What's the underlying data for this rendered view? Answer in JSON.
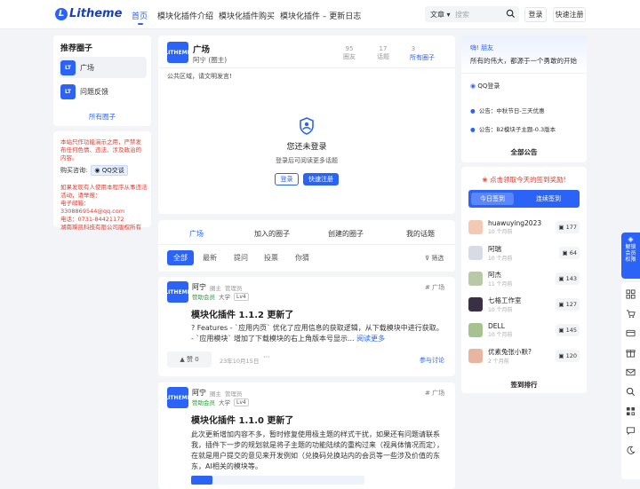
{
  "header": {
    "logo_text": "Litheme",
    "nav": [
      "首页",
      "模块化插件介绍",
      "模块化插件购买",
      "模块化插件 – 更新日志"
    ],
    "search_category": "文章",
    "search_placeholder": "搜索",
    "login": "登录",
    "register": "快速注册"
  },
  "left": {
    "title": "推荐圈子",
    "circles": [
      "广场",
      "问题反馈"
    ],
    "all_circles": "所有圈子",
    "notice": "本站只作功能演示之用，严禁发布任何色情、违法、涉及政治的内容。",
    "contact_label": "购买咨询:",
    "qq_label": "QQ交谈",
    "company_lines": [
      "如果发现有人使用本程序从事违法活动，请举报：",
      "电子邮箱：3308869544@qq.com",
      "电话：0731-84421172",
      "湖南璨凯科技有限公司版权所有"
    ]
  },
  "circle": {
    "name": "广场",
    "owner": "阿宁 (圈主)",
    "stats": [
      {
        "value": "95",
        "label": "圈友"
      },
      {
        "value": "17",
        "label": "话题"
      },
      {
        "value": "3",
        "label": ""
      }
    ],
    "all_circles_link": "所有圈子",
    "public_notice": "公共区域，请文明发言!",
    "not_logged_title": "您还未登录",
    "not_logged_desc": "登录后可阅读更多话题",
    "login_btn": "登录",
    "register_btn": "快速注册"
  },
  "tabs": [
    "广场",
    "加入的圈子",
    "创建的圈子",
    "我的话题"
  ],
  "filters": [
    "全部",
    "最新",
    "提问",
    "投票",
    "你猜"
  ],
  "filter_link": "筛选",
  "posts": [
    {
      "author": "阿宁",
      "role1": "圈主",
      "role2": "管理员",
      "badge": "赞助会员",
      "school": "大学",
      "level": "Lv4",
      "circle": "广场",
      "title": "模块化插件 1.1.2 更新了",
      "body": "? Features - `应用内页` 优化了应用信息的获取逻辑，从下载模块中进行获取。 - `应用模块` 增加了下载模块的右上角版本号显示...",
      "read_more": "阅读更多",
      "likes": "赞 0",
      "date": "23年10月15日",
      "more": "···",
      "join": "参与讨论"
    },
    {
      "author": "阿宁",
      "role1": "圈主",
      "role2": "管理员",
      "badge": "赞助会员",
      "school": "大学",
      "level": "Lv4",
      "circle": "广场",
      "title": "模块化插件 1.1.0 更新了",
      "body": "此次更新增加内容不多，暂时修复使用极主题的样式干扰，如果还有问题请联系我，插件下一步的规划就是将子主题的功能陆续的重构过来（视具体情况而定），在就是用户提交的意见来开发例如（兑换码兑换站内的会员等一些涉及价值的东东，AI相关的模块等。"
    }
  ],
  "right": {
    "greeting": "嗨! 朋友",
    "motto": "所有的伟大，都源于一个勇敢的开始",
    "qq_login": "QQ登录",
    "announcements": [
      "公告：中秋节日-三天优惠",
      "公告：B2模块子主题-0.3版本"
    ],
    "all_announcements": "全部公告",
    "signin_banner": "点击领取今天的签到奖励!",
    "today_signin": "今日签到",
    "streak_signin": "连续签到",
    "ranking": [
      {
        "name": "huawuying2023",
        "sub": "10 个月前",
        "score": "177"
      },
      {
        "name": "阿瑞",
        "sub": "10 个月前",
        "score": "64"
      },
      {
        "name": "阿杰",
        "sub": "11 个月前",
        "score": "143"
      },
      {
        "name": "七格工作室",
        "sub": "10 个月前",
        "score": "127"
      },
      {
        "name": "DELL",
        "sub": "10 个月前",
        "score": "145"
      },
      {
        "name": "优素兔张小默?",
        "sub": "2 个月前",
        "score": "120"
      }
    ],
    "ranking_link": "签到排行"
  },
  "float": {
    "member": "解锁会员权限"
  },
  "colors": {
    "accent": "#2a63f6",
    "warning": "#e0392b"
  }
}
